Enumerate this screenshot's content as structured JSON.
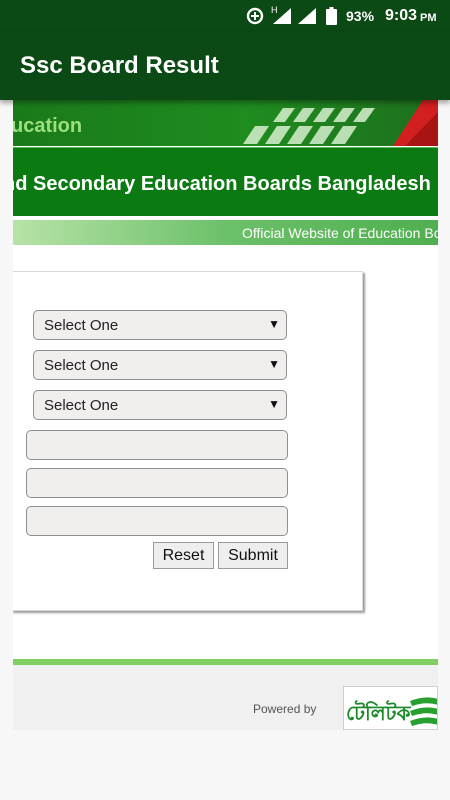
{
  "status_bar": {
    "network_h": "H",
    "battery": "93%",
    "time": "9:03",
    "ampm": "PM"
  },
  "app_bar": {
    "title": "Ssc Board Result"
  },
  "web": {
    "banner_text": "ucation",
    "header_text": "nd Secondary Education Boards Bangladesh",
    "ticker_text": "Official Website of Education Bo",
    "selects": [
      {
        "value": "Select One"
      },
      {
        "value": "Select One"
      },
      {
        "value": "Select One"
      }
    ],
    "inputs": [
      {
        "value": ""
      },
      {
        "value": ""
      },
      {
        "value": ""
      }
    ],
    "reset_label": "Reset",
    "submit_label": "Submit",
    "powered_by": "Powered by",
    "logo_text": "টেলিটক"
  },
  "colors": {
    "app_green": "#0b4a14",
    "header_green": "#0c7a12",
    "accent_light_green": "#7fcf63"
  }
}
